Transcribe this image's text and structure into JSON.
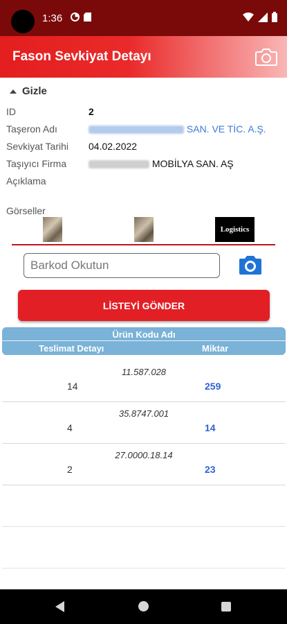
{
  "status_bar": {
    "time": "1:36"
  },
  "app_bar": {
    "title": "Fason Sevkiyat Detayı"
  },
  "toggle": {
    "label": "Gizle"
  },
  "details": {
    "id_label": "ID",
    "id_value": "2",
    "subcontractor_label": "Taşeron Adı",
    "subcontractor_value": "SAN. VE TİC. A.Ş.",
    "shipment_date_label": "Sevkiyat Tarihi",
    "shipment_date_value": "04.02.2022",
    "carrier_label": "Taşıyıcı Firma",
    "carrier_value": "MOBİLYA SAN. AŞ",
    "description_label": "Açıklama",
    "description_value": ""
  },
  "images": {
    "label": "Görseller",
    "logo_text": "Logistics"
  },
  "barcode": {
    "placeholder": "Barkod Okutun"
  },
  "send_button": {
    "label": "LİSTEYİ GÖNDER"
  },
  "table": {
    "header_main": "Ürün Kodu Adı",
    "col_delivery": "Teslimat Detayı",
    "col_quantity": "Miktar",
    "rows": [
      {
        "code": "11.587.028",
        "delivery": "14",
        "quantity": "259"
      },
      {
        "code": "35.8747.001",
        "delivery": "4",
        "quantity": "14"
      },
      {
        "code": "27.0000.18.14",
        "delivery": "2",
        "quantity": "23"
      }
    ]
  },
  "colors": {
    "accent_red": "#e31f26",
    "status_bar": "#7a0a0a",
    "table_header": "#7ab2d8",
    "quantity_blue": "#2f62d6"
  }
}
